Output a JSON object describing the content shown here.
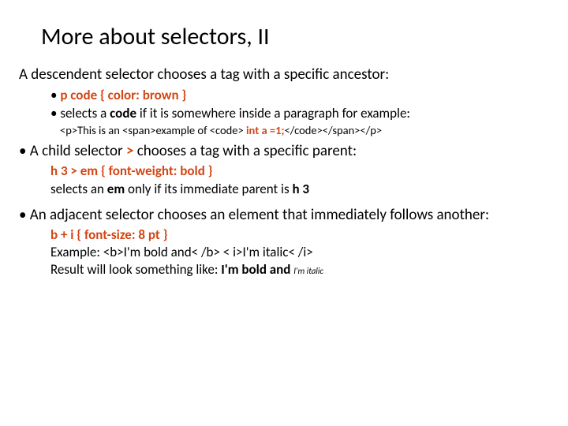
{
  "title": "More about selectors, II",
  "line1_a": "A ",
  "line1_b": "descendent ",
  "line1_c": "selector chooses a tag with a specific ancestor:",
  "rule1": "p code { color: brown }",
  "line2_a": "selects a ",
  "line2_b": "code ",
  "line2_c": "if it is somewhere inside a paragraph for example:",
  "ex1_a": "<p>This is an <span>example of <code> ",
  "ex1_b": "int a =1;",
  "ex1_c": "</code></span></p>",
  "line3_a": "A ",
  "line3_b": "child ",
  "line3_c": "selector ",
  "line3_d": "> ",
  "line3_e": "chooses a tag with a specific parent:",
  "rule2": "h 3 > em { font-weight: bold }",
  "line4_a": "selects an ",
  "line4_b": "em ",
  "line4_c": "only if its immediate parent is ",
  "line4_d": "h 3",
  "line5_a": "An ",
  "line5_b": "adjacent ",
  "line5_c": "selector chooses an element that immediately follows another:",
  "rule3": "b + i  { font-size: 8 pt }",
  "ex2": "Example: <b>I'm bold and< /b>  < i>I'm italic< /i>",
  "res_a": "Result will look something like: ",
  "res_b": "I'm bold and ",
  "res_c": "I'm italic"
}
